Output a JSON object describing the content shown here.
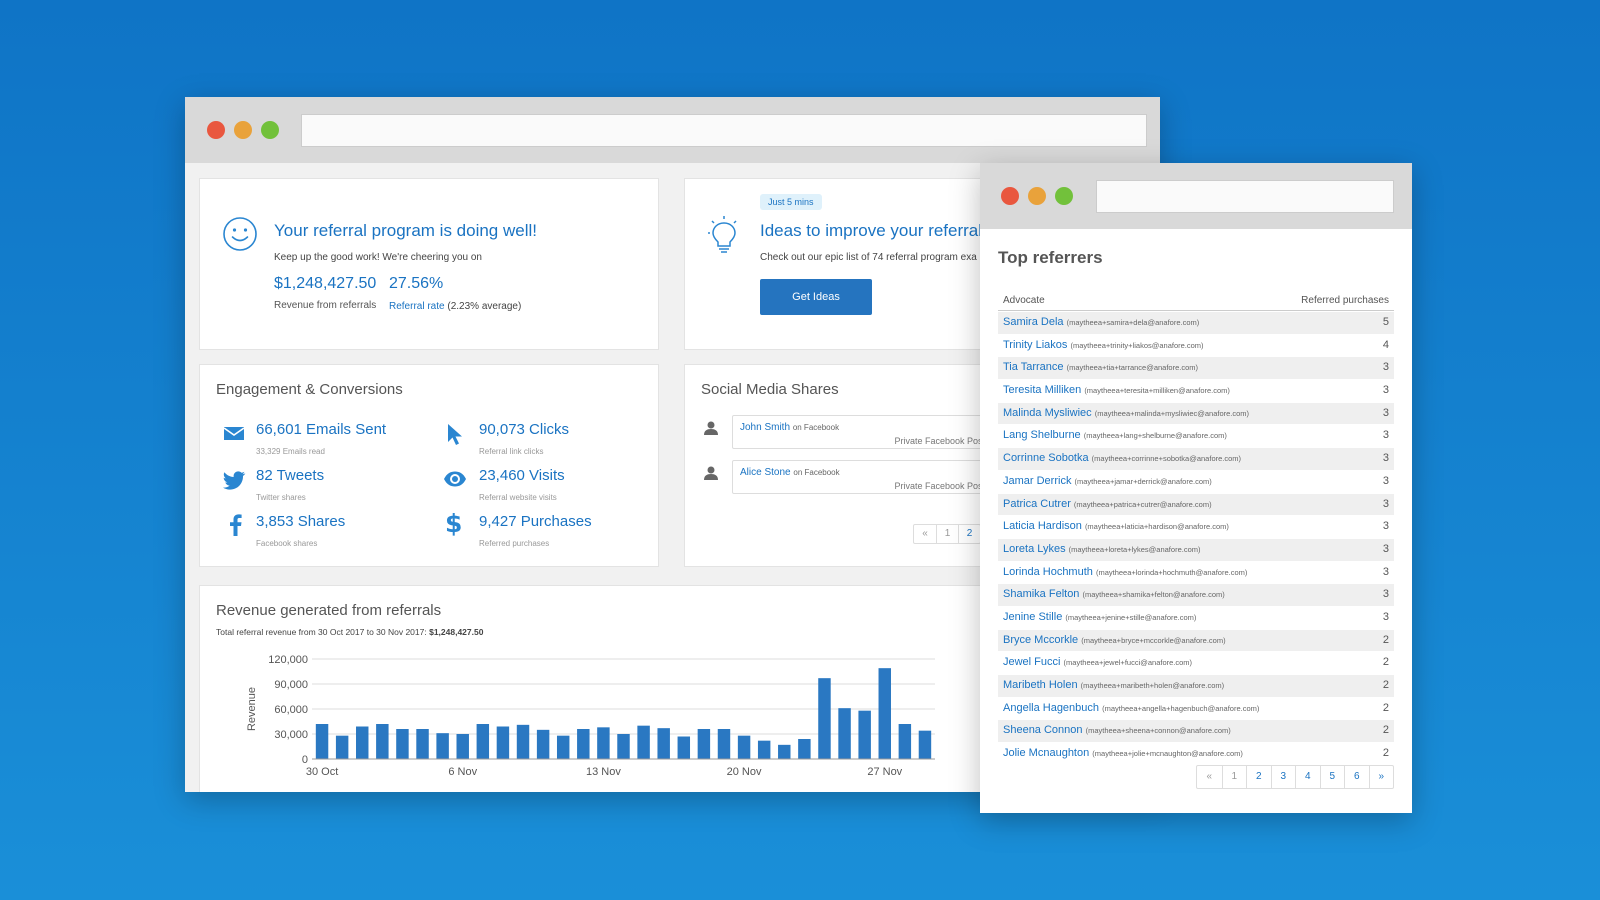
{
  "main_window": {
    "doing_well": {
      "title": "Your referral program is doing well!",
      "subtitle": "Keep up the good work! We're cheering you on",
      "revenue_value": "$1,248,427.50",
      "revenue_label": "Revenue from referrals",
      "rate_value": "27.56%",
      "rate_link": "Referral rate",
      "rate_avg": "(2.23% average)"
    },
    "ideas": {
      "pill": "Just 5 mins",
      "title": "Ideas to improve your referral ra",
      "desc": "Check out our epic list of 74 referral program exa",
      "button": "Get Ideas"
    },
    "engagement": {
      "title": "Engagement & Conversions",
      "stats": [
        {
          "icon": "envelope-icon",
          "value": "66,601 Emails Sent",
          "sub": "33,329 Emails read"
        },
        {
          "icon": "cursor-icon",
          "value": "90,073 Clicks",
          "sub": "Referral link clicks"
        },
        {
          "icon": "twitter-icon",
          "value": "82 Tweets",
          "sub": "Twitter shares"
        },
        {
          "icon": "eye-icon",
          "value": "23,460 Visits",
          "sub": "Referral website visits"
        },
        {
          "icon": "facebook-icon",
          "value": "3,853 Shares",
          "sub": "Facebook shares"
        },
        {
          "icon": "dollar-icon",
          "value": "9,427 Purchases",
          "sub": "Referred purchases"
        }
      ]
    },
    "social": {
      "title": "Social Media Shares",
      "shares": [
        {
          "name": "John Smith",
          "on": "on Facebook",
          "text": "Private Facebook Post"
        },
        {
          "name": "Alice Stone",
          "on": "on Facebook",
          "text": "Private Facebook Post"
        }
      ],
      "pager": [
        "«",
        "1",
        "2"
      ]
    },
    "revenue": {
      "title": "Revenue generated from referrals",
      "subtitle_prefix": "Total referral revenue from 30 Oct 2017 to 30 Nov 2017: ",
      "subtitle_total": "$1,248,427.50"
    }
  },
  "chart_data": {
    "type": "bar",
    "ylabel": "Revenue",
    "xlabel": "",
    "ylim": [
      0,
      120000
    ],
    "yticks": [
      "0",
      "30,000",
      "60,000",
      "90,000",
      "120,000"
    ],
    "xtick_labels": [
      "30 Oct",
      "6 Nov",
      "13 Nov",
      "20 Nov",
      "27 Nov"
    ],
    "xtick_indices": [
      0,
      7,
      14,
      21,
      28
    ],
    "grid": true,
    "color": "#2a78c2",
    "values": [
      42000,
      28000,
      39000,
      42000,
      36000,
      36000,
      31000,
      30000,
      42000,
      39000,
      41000,
      35000,
      28000,
      36000,
      38000,
      30000,
      40000,
      37000,
      27000,
      36000,
      36000,
      28000,
      22000,
      17000,
      24000,
      97000,
      61000,
      58000,
      109000,
      42000,
      34000
    ]
  },
  "referrers_window": {
    "title": "Top referrers",
    "col_advocate": "Advocate",
    "col_purchases": "Referred purchases",
    "rows": [
      {
        "name": "Samira Dela",
        "email": "(maytheea+samira+dela@anafore.com)",
        "count": "5"
      },
      {
        "name": "Trinity Liakos",
        "email": "(maytheea+trinity+liakos@anafore.com)",
        "count": "4"
      },
      {
        "name": "Tia Tarrance",
        "email": "(maytheea+tia+tarrance@anafore.com)",
        "count": "3"
      },
      {
        "name": "Teresita Milliken",
        "email": "(maytheea+teresita+milliken@anafore.com)",
        "count": "3"
      },
      {
        "name": "Malinda Mysliwiec",
        "email": "(maytheea+malinda+mysliwiec@anafore.com)",
        "count": "3"
      },
      {
        "name": "Lang Shelburne",
        "email": "(maytheea+lang+shelburne@anafore.com)",
        "count": "3"
      },
      {
        "name": "Corrinne Sobotka",
        "email": "(maytheea+corrinne+sobotka@anafore.com)",
        "count": "3"
      },
      {
        "name": "Jamar Derrick",
        "email": "(maytheea+jamar+derrick@anafore.com)",
        "count": "3"
      },
      {
        "name": "Patrica Cutrer",
        "email": "(maytheea+patrica+cutrer@anafore.com)",
        "count": "3"
      },
      {
        "name": "Laticia Hardison",
        "email": "(maytheea+laticia+hardison@anafore.com)",
        "count": "3"
      },
      {
        "name": "Loreta Lykes",
        "email": "(maytheea+loreta+lykes@anafore.com)",
        "count": "3"
      },
      {
        "name": "Lorinda Hochmuth",
        "email": "(maytheea+lorinda+hochmuth@anafore.com)",
        "count": "3"
      },
      {
        "name": "Shamika Felton",
        "email": "(maytheea+shamika+felton@anafore.com)",
        "count": "3"
      },
      {
        "name": "Jenine Stille",
        "email": "(maytheea+jenine+stille@anafore.com)",
        "count": "3"
      },
      {
        "name": "Bryce Mccorkle",
        "email": "(maytheea+bryce+mccorkle@anafore.com)",
        "count": "2"
      },
      {
        "name": "Jewel Fucci",
        "email": "(maytheea+jewel+fucci@anafore.com)",
        "count": "2"
      },
      {
        "name": "Maribeth Holen",
        "email": "(maytheea+maribeth+holen@anafore.com)",
        "count": "2"
      },
      {
        "name": "Angella Hagenbuch",
        "email": "(maytheea+angella+hagenbuch@anafore.com)",
        "count": "2"
      },
      {
        "name": "Sheena Connon",
        "email": "(maytheea+sheena+connon@anafore.com)",
        "count": "2"
      },
      {
        "name": "Jolie Mcnaughton",
        "email": "(maytheea+jolie+mcnaughton@anafore.com)",
        "count": "2"
      }
    ],
    "pager": [
      "«",
      "1",
      "2",
      "3",
      "4",
      "5",
      "6",
      "»"
    ]
  },
  "colors": {
    "accent": "#1a73c2",
    "button": "#2574bf",
    "close": "#e9573f",
    "minimize": "#e9a23b",
    "maximize": "#72c13b",
    "background": "#1587d3"
  }
}
